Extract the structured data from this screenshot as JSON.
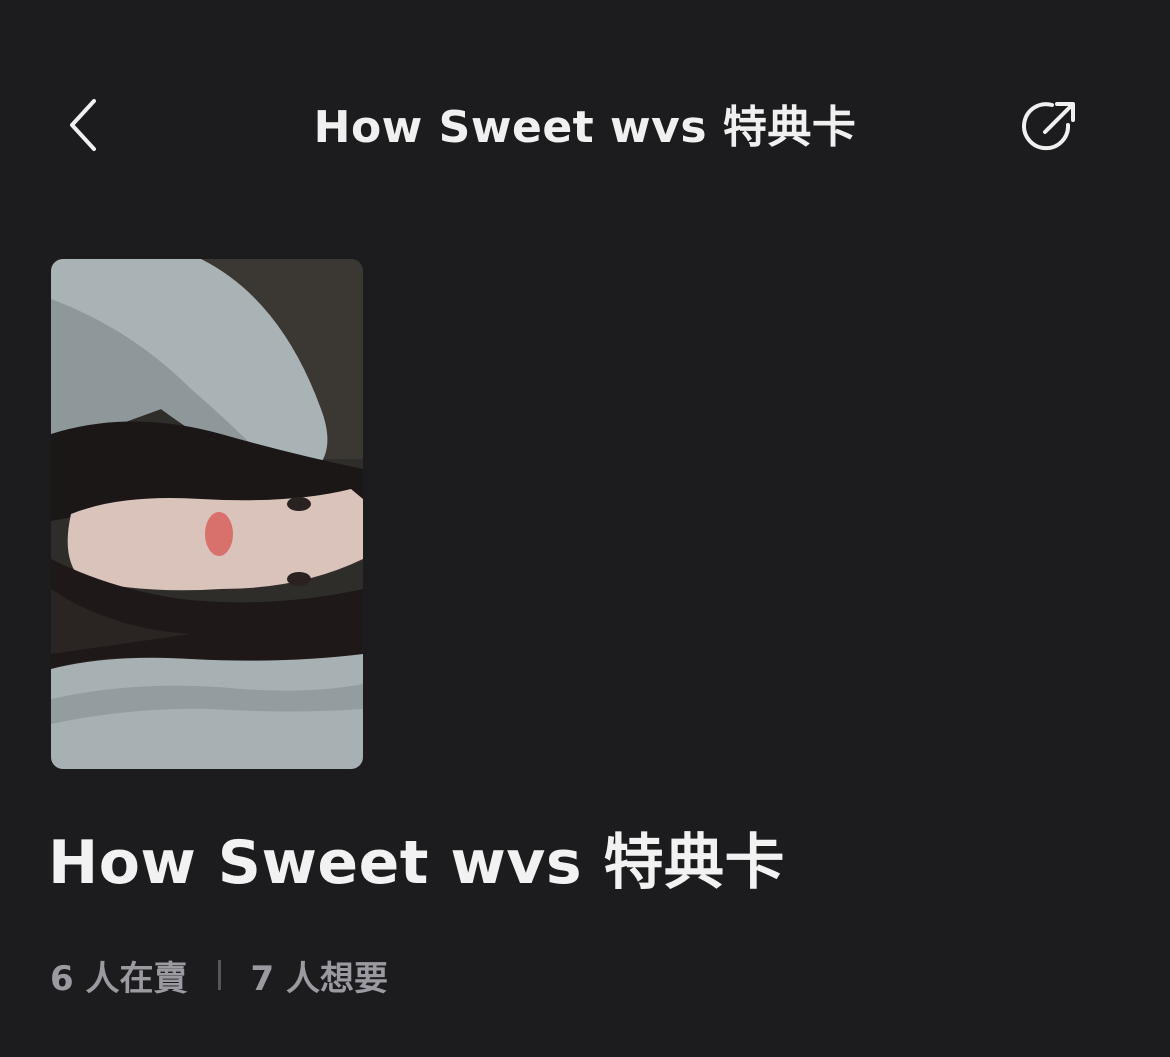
{
  "header": {
    "title": "How Sweet wvs 特典卡",
    "back_icon": "chevron-left-icon",
    "share_icon": "share-external-icon"
  },
  "product": {
    "image_alt": "photocard",
    "title": "How Sweet wvs 特典卡",
    "selling_text": "6 人在賣",
    "wanting_text": "7 人想要"
  },
  "colors": {
    "background": "#1c1c1f",
    "text_primary": "#f2f2f2",
    "text_secondary": "#9a9aa0"
  }
}
